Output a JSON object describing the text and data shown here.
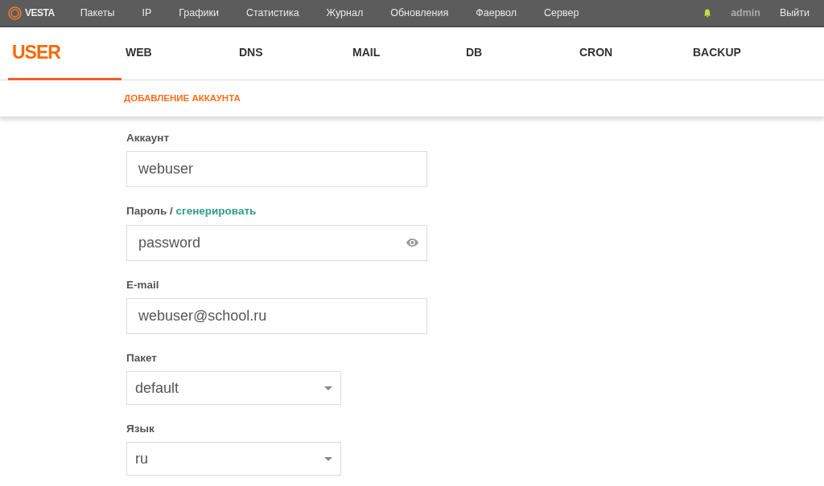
{
  "logo": {
    "text": "VESTA"
  },
  "top_menu": [
    {
      "label": "Пакеты"
    },
    {
      "label": "IP"
    },
    {
      "label": "Графики"
    },
    {
      "label": "Статистика"
    },
    {
      "label": "Журнал"
    },
    {
      "label": "Обновления"
    },
    {
      "label": "Фаервол"
    },
    {
      "label": "Сервер"
    }
  ],
  "user": {
    "name": "admin",
    "logout": "Выйти"
  },
  "tabs": [
    {
      "label": "USER",
      "selected": true
    },
    {
      "label": "WEB",
      "selected": false
    },
    {
      "label": "DNS",
      "selected": false
    },
    {
      "label": "MAIL",
      "selected": false
    },
    {
      "label": "DB",
      "selected": false
    },
    {
      "label": "CRON",
      "selected": false
    },
    {
      "label": "BACKUP",
      "selected": false
    }
  ],
  "subtitle": "ДОБАВЛЕНИЕ АККАУНТА",
  "fields": [
    {
      "kind": "text",
      "label": "Аккаунт",
      "value": "webuser"
    },
    {
      "kind": "password",
      "label": "Пароль /",
      "link": "сгенерировать",
      "value": "password"
    },
    {
      "kind": "text",
      "label": "E-mail",
      "value": "webuser@school.ru"
    },
    {
      "kind": "select",
      "label": "Пакет",
      "value": "default"
    },
    {
      "kind": "select",
      "label": "Язык",
      "value": "ru"
    }
  ]
}
